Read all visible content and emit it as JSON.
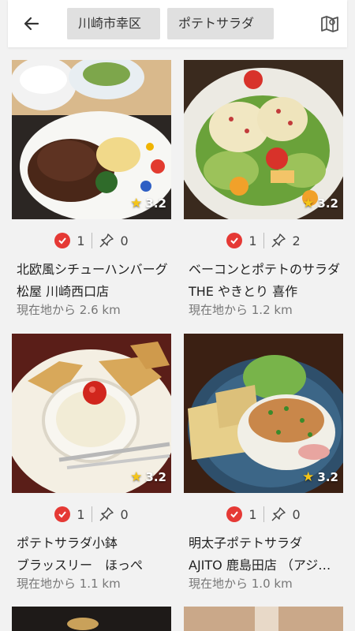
{
  "header": {
    "chips": [
      "川崎市幸区",
      "ポテトサラダ"
    ],
    "back_icon": "arrow-left-icon",
    "map_icon": "map-icon"
  },
  "colors": {
    "accent_red": "#e53935",
    "star": "#f5c518"
  },
  "cards": [
    {
      "rating": "3.2",
      "checks": "1",
      "pins": "0",
      "title": "北欧風シチューハンバーグ",
      "shop": "松屋 川崎西口店",
      "distance": "現在地から 2.6 km"
    },
    {
      "rating": "3.2",
      "checks": "1",
      "pins": "2",
      "title": "ベーコンとポテトのサラダ",
      "shop": "THE やきとり 喜作",
      "distance": "現在地から 1.2 km"
    },
    {
      "rating": "3.2",
      "checks": "1",
      "pins": "0",
      "title": "ポテトサラダ小鉢",
      "shop": "ブラッスリー　ほっぺ",
      "distance": "現在地から 1.1 km"
    },
    {
      "rating": "3.2",
      "checks": "1",
      "pins": "0",
      "title": "明太子ポテトサラダ",
      "shop": "AJITO 鹿島田店 （アジト）",
      "distance": "現在地から 1.0 km"
    }
  ]
}
